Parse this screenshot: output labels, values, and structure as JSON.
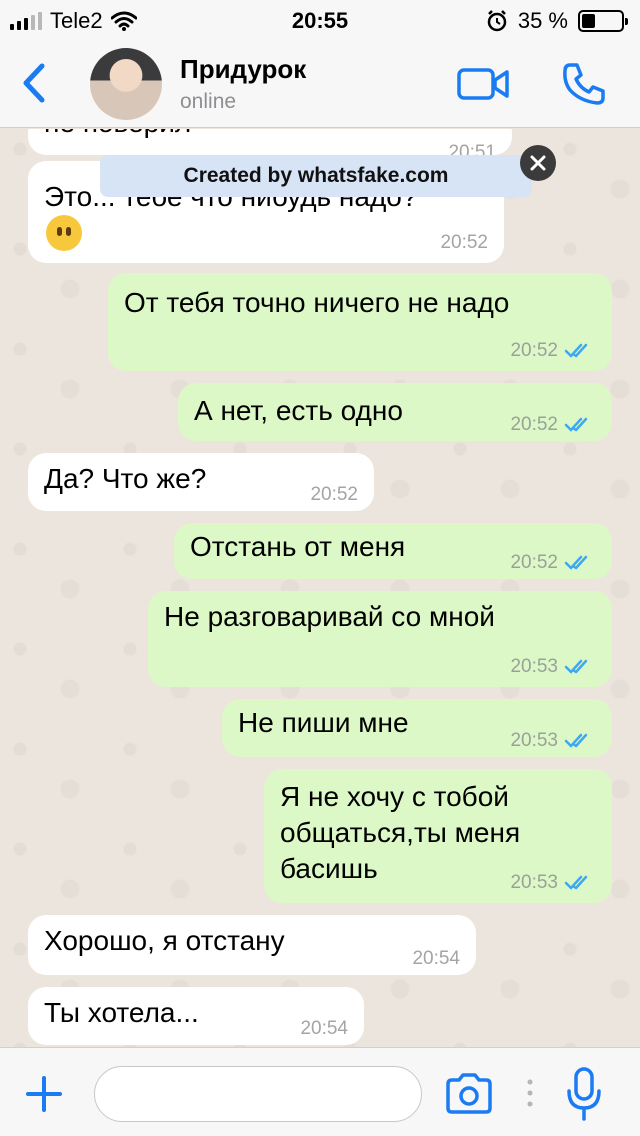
{
  "status_bar": {
    "carrier": "Tele2",
    "time": "20:55",
    "battery_percent": "35 %",
    "battery_level": 0.35,
    "icons": [
      "signal-icon",
      "wifi-icon",
      "alarm-icon",
      "battery-icon"
    ]
  },
  "header": {
    "contact_name": "Придурок",
    "contact_status": "online",
    "icons": [
      "back-chevron-icon",
      "avatar",
      "video-call-icon",
      "phone-icon"
    ]
  },
  "watermark": {
    "text": "Created by whatsfake.com",
    "close_icon": "close-icon"
  },
  "messages": [
    {
      "dir": "in",
      "text": "не поверил",
      "time": "20:51"
    },
    {
      "dir": "in",
      "text": "Это... тебе что нибудь надо?",
      "emoji": "neutral-face-emoji",
      "time": "20:52"
    },
    {
      "dir": "out",
      "text": "От тебя точно ничего не надо",
      "time": "20:52",
      "read": true
    },
    {
      "dir": "out",
      "text": "А нет, есть одно",
      "time": "20:52",
      "read": true
    },
    {
      "dir": "in",
      "text": "Да? Что же?",
      "time": "20:52"
    },
    {
      "dir": "out",
      "text": "Отстань от меня",
      "time": "20:52",
      "read": true
    },
    {
      "dir": "out",
      "text": "Не разговаривай со мной",
      "time": "20:53",
      "read": true
    },
    {
      "dir": "out",
      "text": "Не пиши мне",
      "time": "20:53",
      "read": true
    },
    {
      "dir": "out",
      "text": "Я не хочу с тобой\nобщаться,ты меня\nбасишь",
      "time": "20:53",
      "read": true
    },
    {
      "dir": "in",
      "text": "Хорошо, я отстану",
      "time": "20:54"
    },
    {
      "dir": "in",
      "text": "Ты хотела...",
      "time": "20:54"
    }
  ],
  "input_bar": {
    "value": "",
    "icons": [
      "plus-icon",
      "camera-icon",
      "more-dots-icon",
      "microphone-icon"
    ]
  },
  "colors": {
    "accent": "#1a7bf2",
    "outgoing_bubble": "#dcf8c6",
    "incoming_bubble": "#ffffff",
    "read_ticks": "#3ea8f0",
    "chat_background": "#ece5dd"
  }
}
